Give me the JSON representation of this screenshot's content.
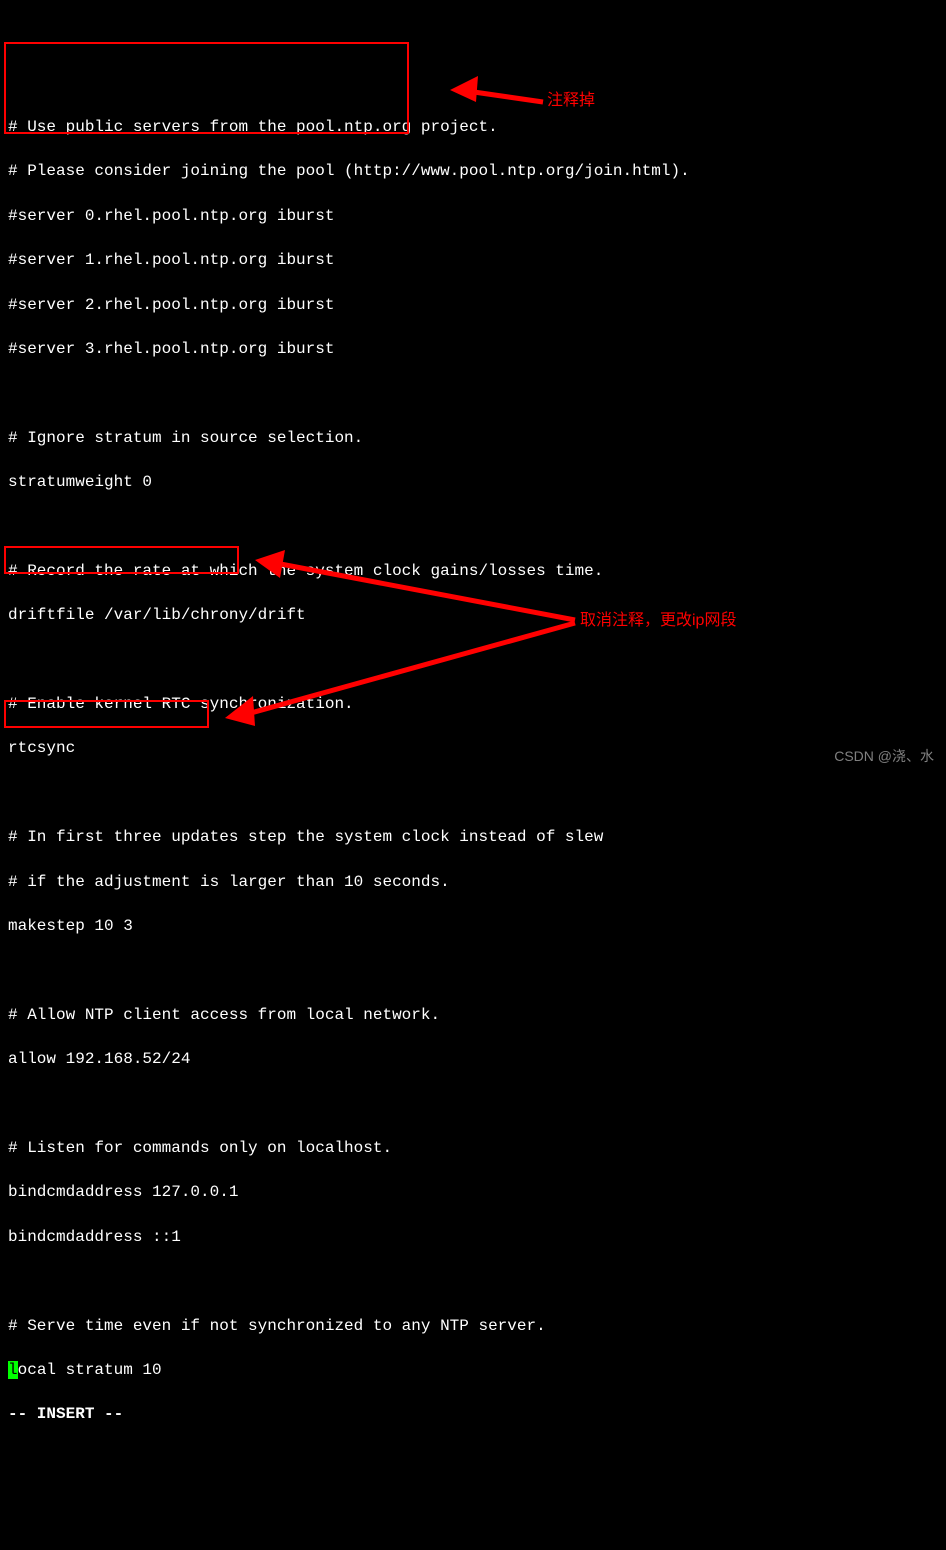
{
  "terminal": {
    "lines": [
      "# Use public servers from the pool.ntp.org project.",
      "# Please consider joining the pool (http://www.pool.ntp.org/join.html).",
      "#server 0.rhel.pool.ntp.org iburst",
      "#server 1.rhel.pool.ntp.org iburst",
      "#server 2.rhel.pool.ntp.org iburst",
      "#server 3.rhel.pool.ntp.org iburst",
      "",
      "# Ignore stratum in source selection.",
      "stratumweight 0",
      "",
      "# Record the rate at which the system clock gains/losses time.",
      "driftfile /var/lib/chrony/drift",
      "",
      "# Enable kernel RTC synchronization.",
      "rtcsync",
      "",
      "# In first three updates step the system clock instead of slew",
      "# if the adjustment is larger than 10 seconds.",
      "makestep 10 3",
      "",
      "# Allow NTP client access from local network.",
      "allow 192.168.52/24",
      "",
      "# Listen for commands only on localhost.",
      "bindcmdaddress 127.0.0.1",
      "bindcmdaddress ::1",
      "",
      "# Serve time even if not synchronized to any NTP server."
    ],
    "local_stratum_prefix": "l",
    "local_stratum_rest": "ocal stratum 10",
    "mode_line": "-- INSERT --"
  },
  "annotations": {
    "comment_out": "注释掉",
    "uncomment_change_ip": "取消注释，更改ip网段"
  },
  "watermark": "CSDN @浇、水",
  "colors": {
    "text": "#ffffff",
    "background": "#000000",
    "highlight_border": "#ff0000",
    "annotation_text": "#ff0000",
    "cursor_bg": "#00ff00",
    "watermark": "#808080"
  }
}
